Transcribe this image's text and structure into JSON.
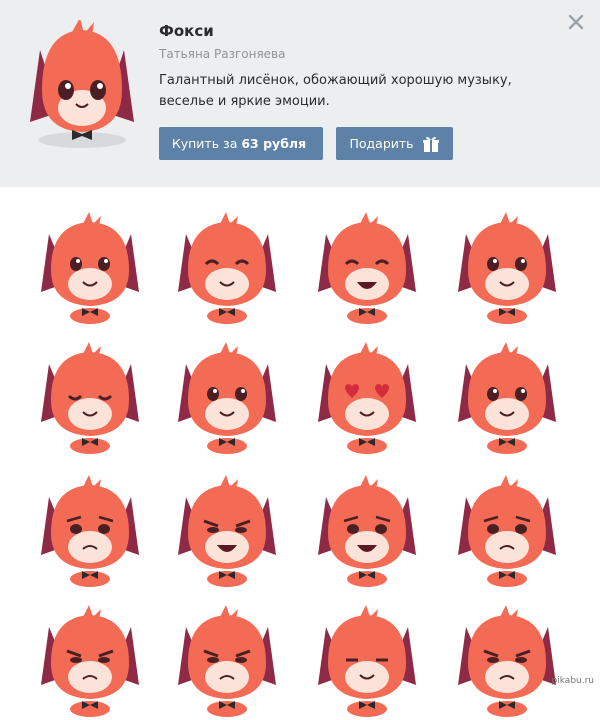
{
  "pack": {
    "title": "Фокси",
    "author": "Татьяна Разгоняева",
    "description": "Галантный лисёнок, обожающий хорошую музыку, веселье и яркие эмоции.",
    "buy_prefix": "Купить за",
    "buy_price": "63 рубля",
    "gift_label": "Подарить"
  },
  "icons": {
    "close": "close-icon",
    "gift": "gift-icon"
  },
  "colors": {
    "header_bg": "#edeef0",
    "button_bg": "#5e81a8",
    "fox_orange": "#f36a55",
    "fox_dark": "#8e2a45"
  },
  "stickers": [
    {
      "id": "fox-happy",
      "emotion": "smile"
    },
    {
      "id": "fox-wave-paw",
      "emotion": "wink"
    },
    {
      "id": "fox-thumbs-up",
      "emotion": "laugh"
    },
    {
      "id": "fox-bowtie",
      "emotion": "smile"
    },
    {
      "id": "fox-hug-tail",
      "emotion": "shy"
    },
    {
      "id": "fox-roses",
      "emotion": "smile"
    },
    {
      "id": "fox-heart-eyes",
      "emotion": "love"
    },
    {
      "id": "fox-heart",
      "emotion": "smile"
    },
    {
      "id": "fox-sad",
      "emotion": "sad"
    },
    {
      "id": "fox-nervous",
      "emotion": "grit"
    },
    {
      "id": "fox-crying",
      "emotion": "cry"
    },
    {
      "id": "fox-tearful",
      "emotion": "sad"
    },
    {
      "id": "fox-annoyed",
      "emotion": "annoyed"
    },
    {
      "id": "fox-skeptical",
      "emotion": "skeptic"
    },
    {
      "id": "fox-sleepy",
      "emotion": "sleepy"
    },
    {
      "id": "fox-angry",
      "emotion": "angry"
    }
  ],
  "watermark": "pikabu.ru"
}
